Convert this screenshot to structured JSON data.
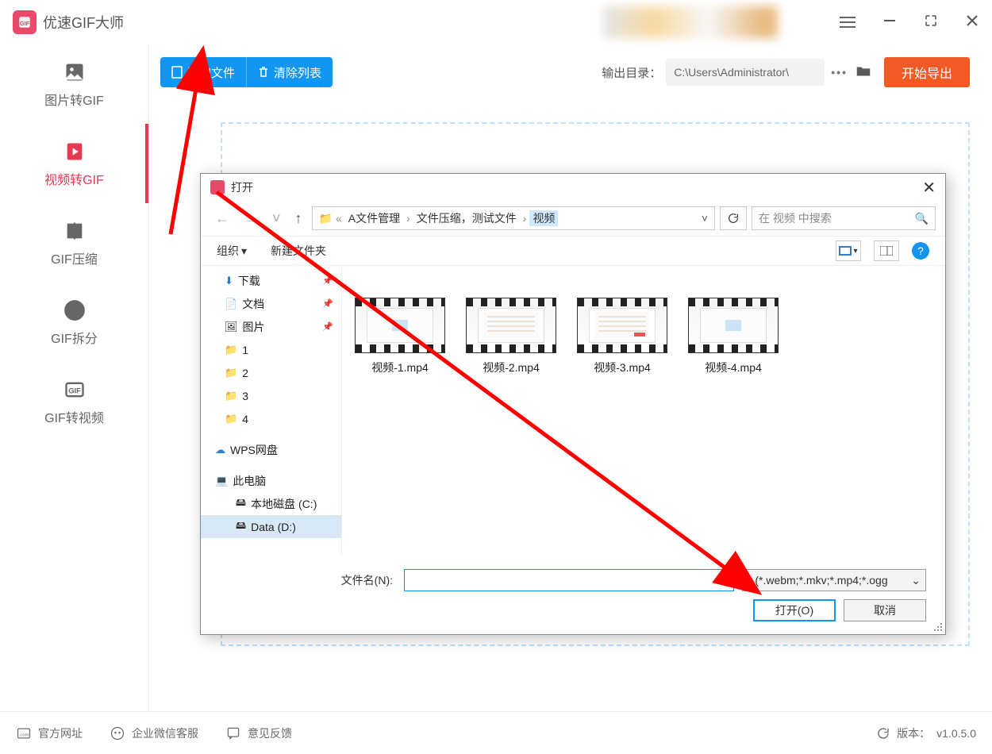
{
  "app": {
    "title": "优速GIF大师",
    "version_label": "版本：",
    "version": "v1.0.5.0"
  },
  "sidebar": {
    "items": [
      {
        "label": "图片转GIF"
      },
      {
        "label": "视频转GIF"
      },
      {
        "label": "GIF压缩"
      },
      {
        "label": "GIF拆分"
      },
      {
        "label": "GIF转视频"
      }
    ]
  },
  "toolbar": {
    "add_file": "添加文件",
    "clear_list": "清除列表",
    "output_dir_label": "输出目录：",
    "output_dir_value": "C:\\Users\\Administrator\\",
    "export": "开始导出"
  },
  "footer": {
    "official_site": "官方网址",
    "wechat_support": "企业微信客服",
    "feedback": "意见反馈"
  },
  "dialog": {
    "title": "打开",
    "breadcrumb": {
      "p1": "A文件管理",
      "p2": "文件压缩，测试文件",
      "p3": "视频"
    },
    "search_placeholder": "在 视频 中搜索",
    "organize": "组织",
    "new_folder": "新建文件夹",
    "tree": {
      "downloads": "下载",
      "documents": "文档",
      "pictures": "图片",
      "f1": "1",
      "f2": "2",
      "f3": "3",
      "f4": "4",
      "wps": "WPS网盘",
      "thispc": "此电脑",
      "cdrive": "本地磁盘 (C:)",
      "ddrive": "Data (D:)"
    },
    "files": [
      {
        "name": "视频-1.mp4"
      },
      {
        "name": "视频-2.mp4"
      },
      {
        "name": "视频-3.mp4"
      },
      {
        "name": "视频-4.mp4"
      }
    ],
    "filename_label": "文件名(N):",
    "filetype_filter": "* (*.webm;*.mkv;*.mp4;*.ogg",
    "open_btn": "打开(O)",
    "cancel_btn": "取消"
  }
}
